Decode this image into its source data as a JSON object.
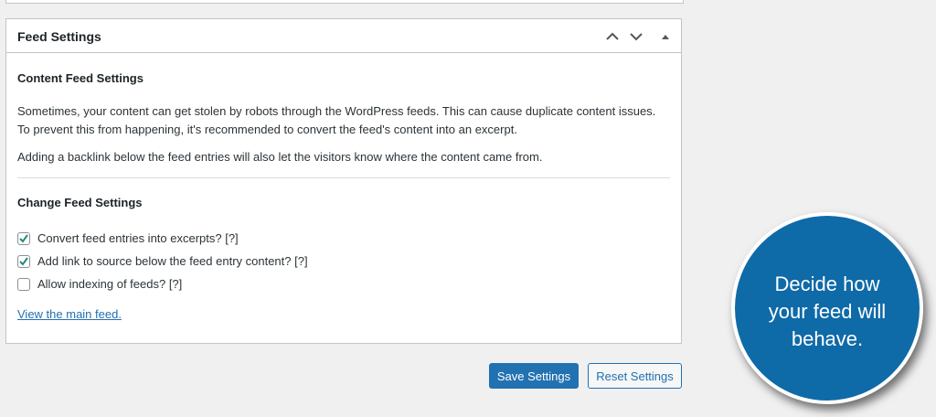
{
  "panel": {
    "title": "Feed Settings",
    "controls": [
      {
        "name": "move-up-icon"
      },
      {
        "name": "move-down-icon"
      },
      {
        "name": "toggle-panel-icon"
      }
    ]
  },
  "content": {
    "heading": "Content Feed Settings",
    "paragraph1": "Sometimes, your content can get stolen by robots through the WordPress feeds. This can cause duplicate content issues. To prevent this from happening, it's recommended to convert the feed's content into an excerpt.",
    "paragraph2": "Adding a backlink below the feed entries will also let the visitors know where the content came from."
  },
  "change": {
    "heading": "Change Feed Settings",
    "options": [
      {
        "label": "Convert feed entries into excerpts? [?]",
        "checked": true
      },
      {
        "label": "Add link to source below the feed entry content? [?]",
        "checked": true
      },
      {
        "label": "Allow indexing of feeds? [?]",
        "checked": false
      }
    ],
    "link": "View the main feed."
  },
  "buttons": {
    "save": "Save Settings",
    "reset": "Reset Settings"
  },
  "callout": {
    "text": "Decide how your feed will behave."
  },
  "colors": {
    "accent": "#2271b1",
    "checkmark": "#1e8c7e",
    "callout": "#0f6aa8"
  }
}
